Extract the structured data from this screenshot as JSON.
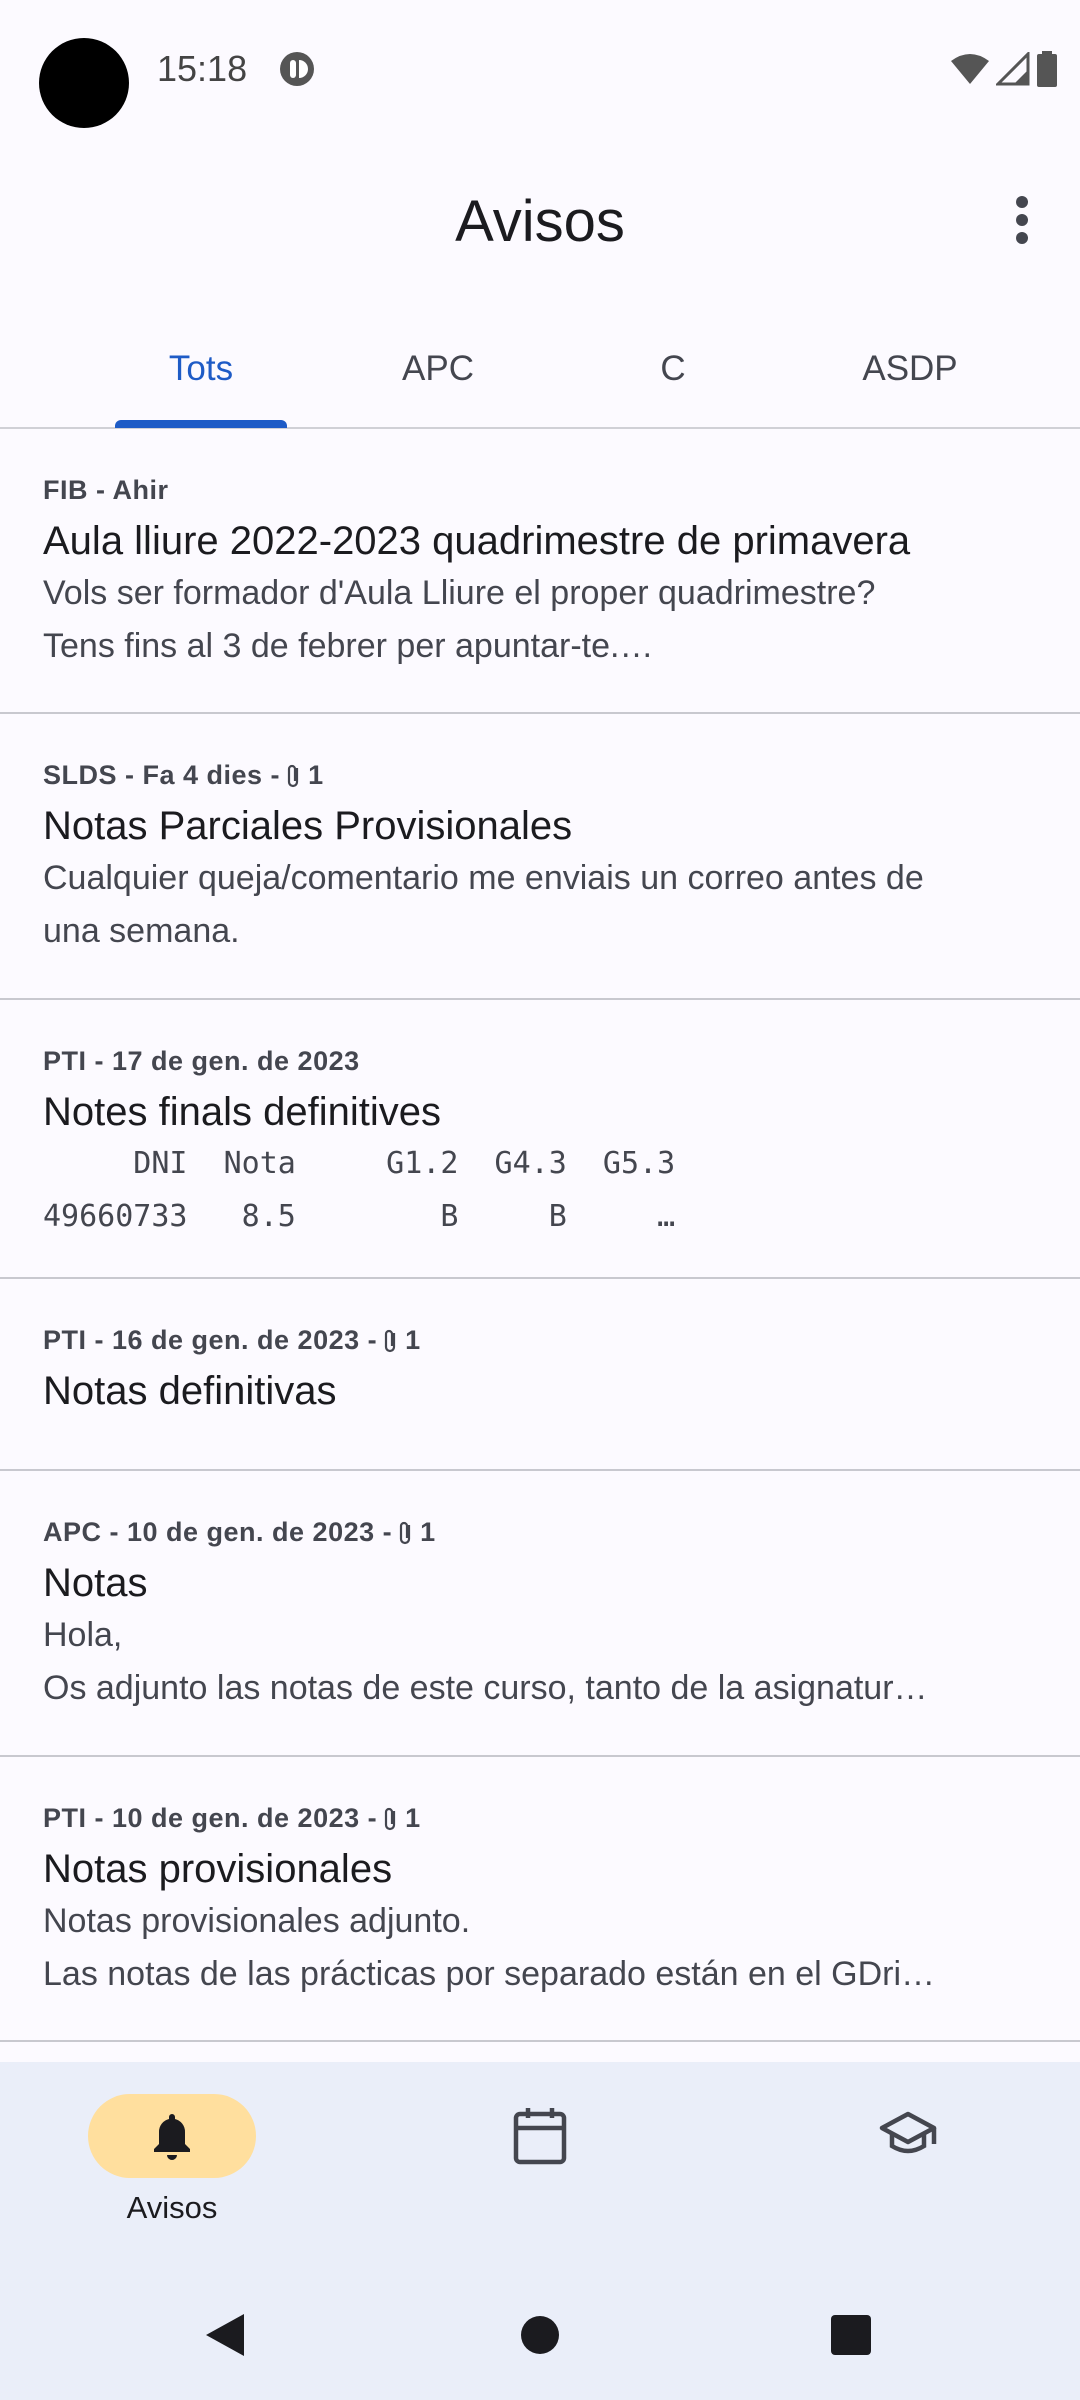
{
  "status_bar": {
    "time": "15:18",
    "icons": [
      "camera-cutout",
      "app-notification-icon",
      "wifi-icon",
      "cellular-signal-icon",
      "battery-icon"
    ]
  },
  "header": {
    "title": "Avisos",
    "menu_icon": "more-vert-icon"
  },
  "tabs": [
    {
      "label": "Tots",
      "active": true
    },
    {
      "label": "APC",
      "active": false
    },
    {
      "label": "C",
      "active": false
    },
    {
      "label": "ASDP",
      "active": false
    }
  ],
  "notices": [
    {
      "meta": "FIB - Ahir",
      "attachments": "",
      "title": "Aula lliure 2022-2023 quadrimestre de primavera",
      "body": [
        "Vols ser formador d'Aula Lliure el proper quadrimestre?",
        "Tens fins al 3 de febrer per apuntar-te.…"
      ]
    },
    {
      "meta": "SLDS - Fa 4 dies -",
      "attachments": "1",
      "title": "Notas Parciales Provisionales",
      "body": [
        "Cualquier queja/comentario me enviais un correo antes de",
        "una semana."
      ]
    },
    {
      "meta": "PTI - 17 de gen. de 2023",
      "attachments": "",
      "title": "Notes finals definitives",
      "body": [
        "     DNI  Nota     G1.2  G4.3  G5.3",
        "49660733   8.5        B     B     …"
      ]
    },
    {
      "meta": "PTI - 16 de gen. de 2023 -",
      "attachments": "1",
      "title": "Notas definitivas",
      "body": []
    },
    {
      "meta": "APC - 10 de gen. de 2023 -",
      "attachments": "1",
      "title": "Notas",
      "body": [
        "Hola,",
        "Os adjunto las notas de este curso, tanto de la asignatur…"
      ]
    },
    {
      "meta": "PTI - 10 de gen. de 2023 -",
      "attachments": "1",
      "title": "Notas provisionales",
      "body": [
        "Notas provisionales adjunto.",
        "Las notas de las prácticas por separado están en el GDri…"
      ]
    }
  ],
  "bottom_nav": [
    {
      "label": "Avisos",
      "icon": "bell-icon",
      "active": true
    },
    {
      "label": "",
      "icon": "calendar-icon",
      "active": false
    },
    {
      "label": "",
      "icon": "graduation-cap-icon",
      "active": false
    }
  ],
  "system_nav": [
    "back-icon",
    "home-icon",
    "recents-icon"
  ],
  "colors": {
    "accent": "#1e5bc6",
    "nav_active_pill": "#ffdf9e",
    "nav_background": "#eaeef9",
    "background": "#fcfaff"
  }
}
